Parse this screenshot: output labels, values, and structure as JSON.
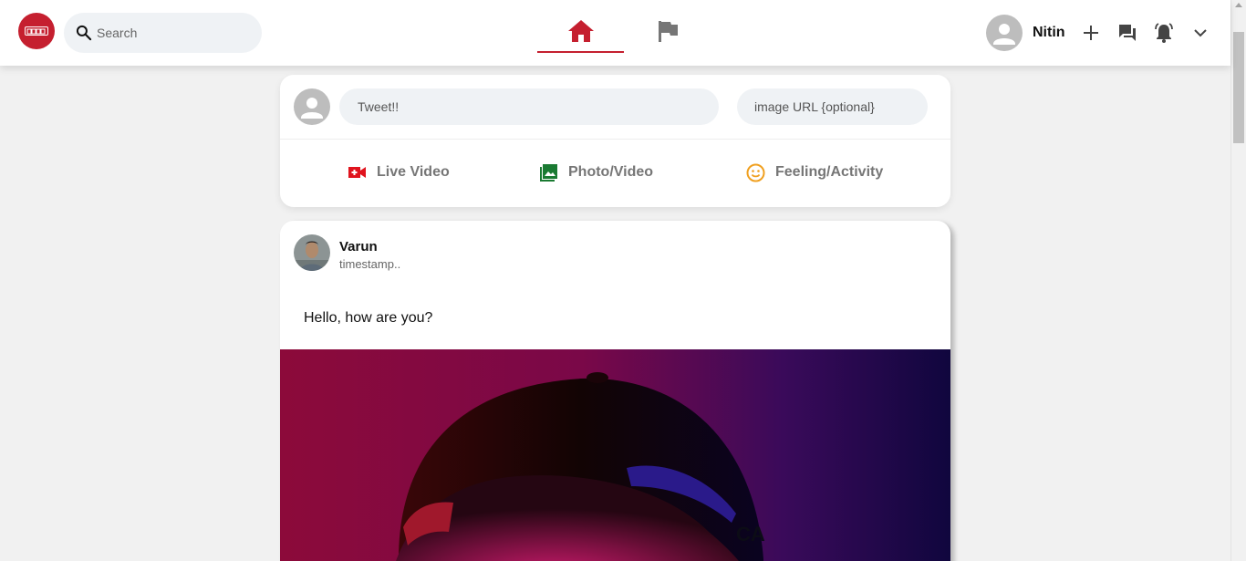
{
  "header": {
    "search": {
      "placeholder": "Search"
    },
    "user": {
      "name": "Nitin"
    },
    "accent": "#c51f2f"
  },
  "composer": {
    "tweet_placeholder": "Tweet!!",
    "image_placeholder": "image URL {optional}",
    "options": [
      {
        "label": "Live Video",
        "icon": "video-camera-icon",
        "color": "#e0141e"
      },
      {
        "label": "Photo/Video",
        "icon": "photo-library-icon",
        "color": "#1a7a32"
      },
      {
        "label": "Feeling/Activity",
        "icon": "smiley-icon",
        "color": "#f0a020"
      }
    ]
  },
  "post": {
    "author": "Varun",
    "timestamp": "timestamp..",
    "text": "Hello, how are you?"
  }
}
